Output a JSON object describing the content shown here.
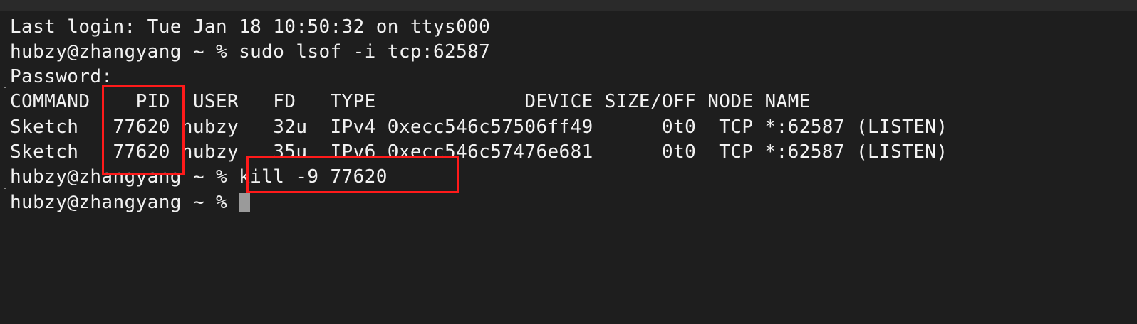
{
  "terminal": {
    "lines": [
      "Last login: Tue Jan 18 10:50:32 on ttys000",
      "hubzy@zhangyang ~ % sudo lsof -i tcp:62587",
      "Password:",
      "COMMAND    PID  USER   FD   TYPE             DEVICE SIZE/OFF NODE NAME",
      "Sketch   77620 hubzy   32u  IPv4 0xecc546c57506ff49      0t0  TCP *:62587 (LISTEN)",
      "Sketch   77620 hubzy   35u  IPv6 0xecc546c57476e681      0t0  TCP *:62587 (LISTEN)",
      "hubzy@zhangyang ~ % kill -9 77620",
      "hubzy@zhangyang ~ % "
    ]
  },
  "annotations": {
    "highlight_color": "#ff1a1a"
  }
}
